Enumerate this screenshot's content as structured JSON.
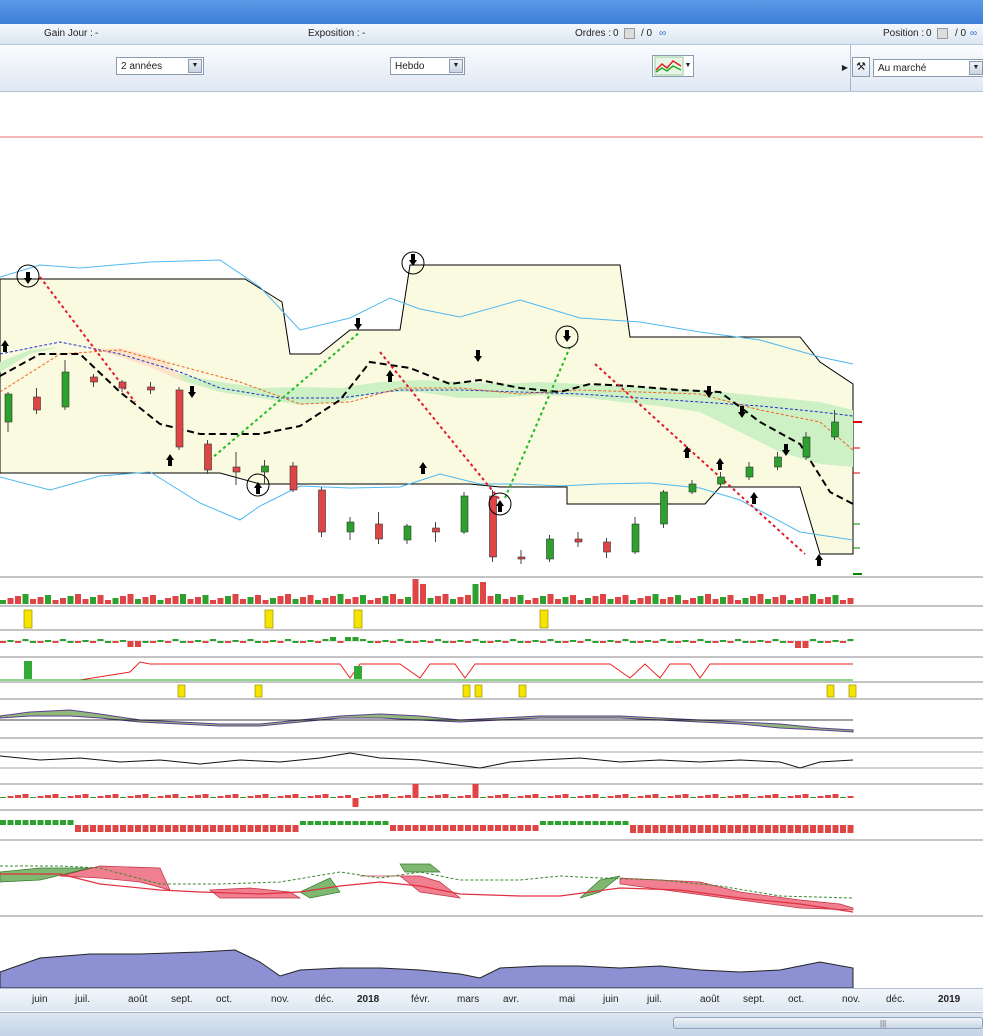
{
  "infobar": {
    "gain_label": "Gain Jour :",
    "gain_value": "-",
    "exposition_label": "Exposition :",
    "exposition_value": "-",
    "ordres_label": "Ordres :",
    "ordres_value1": "0",
    "ordres_value2": "/ 0",
    "position_label": "Position :",
    "position_value1": "0",
    "position_value2": "/ 0"
  },
  "toolbar": {
    "period_select": "2 années",
    "interval_select": "Hebdo",
    "order_type_select": "Au marché"
  },
  "xaxis": {
    "labels": [
      "juin",
      "juil.",
      "août",
      "sept.",
      "oct.",
      "nov.",
      "déc.",
      "2018",
      "févr.",
      "mars",
      "avr.",
      "mai",
      "juin",
      "juil.",
      "août",
      "sept.",
      "oct.",
      "nov.",
      "déc.",
      "2019"
    ],
    "bold_labels": [
      "2018",
      "2019"
    ]
  },
  "chart_data": {
    "type": "candlestick",
    "x": [
      "juin",
      "juil.",
      "août",
      "sept.",
      "oct.",
      "nov.",
      "déc.",
      "2018",
      "févr.",
      "mars",
      "avr.",
      "mai",
      "juin",
      "juil.",
      "août",
      "sept.",
      "oct.",
      "nov."
    ],
    "candles": [
      {
        "o": 330,
        "c": 302,
        "h": 300,
        "l": 340
      },
      {
        "o": 305,
        "c": 318,
        "h": 296,
        "l": 322
      },
      {
        "o": 315,
        "c": 280,
        "h": 268,
        "l": 318
      },
      {
        "o": 285,
        "c": 290,
        "h": 282,
        "l": 295
      },
      {
        "o": 290,
        "c": 296,
        "h": 288,
        "l": 300
      },
      {
        "o": 295,
        "c": 298,
        "h": 290,
        "l": 302
      },
      {
        "o": 298,
        "c": 355,
        "h": 295,
        "l": 358
      },
      {
        "o": 352,
        "c": 378,
        "h": 348,
        "l": 382
      },
      {
        "o": 375,
        "c": 380,
        "h": 360,
        "l": 393
      },
      {
        "o": 380,
        "c": 374,
        "h": 368,
        "l": 392
      },
      {
        "o": 374,
        "c": 398,
        "h": 370,
        "l": 400
      },
      {
        "o": 398,
        "c": 440,
        "h": 395,
        "l": 445
      },
      {
        "o": 440,
        "c": 430,
        "h": 425,
        "l": 448
      },
      {
        "o": 432,
        "c": 447,
        "h": 420,
        "l": 452
      },
      {
        "o": 448,
        "c": 434,
        "h": 432,
        "l": 452
      },
      {
        "o": 436,
        "c": 440,
        "h": 430,
        "l": 450
      },
      {
        "o": 440,
        "c": 404,
        "h": 400,
        "l": 442
      },
      {
        "o": 404,
        "c": 465,
        "h": 398,
        "l": 470
      },
      {
        "o": 465,
        "c": 467,
        "h": 458,
        "l": 472
      },
      {
        "o": 467,
        "c": 447,
        "h": 443,
        "l": 470
      },
      {
        "o": 447,
        "c": 450,
        "h": 440,
        "l": 455
      },
      {
        "o": 450,
        "c": 460,
        "h": 446,
        "l": 466
      },
      {
        "o": 460,
        "c": 432,
        "h": 425,
        "l": 462
      },
      {
        "o": 432,
        "c": 400,
        "h": 398,
        "l": 436
      },
      {
        "o": 400,
        "c": 392,
        "h": 388,
        "l": 402
      },
      {
        "o": 392,
        "c": 385,
        "h": 380,
        "l": 395
      },
      {
        "o": 385,
        "c": 375,
        "h": 370,
        "l": 388
      },
      {
        "o": 375,
        "c": 365,
        "h": 360,
        "l": 378
      },
      {
        "o": 365,
        "c": 345,
        "h": 340,
        "l": 368
      },
      {
        "o": 345,
        "c": 330,
        "h": 318,
        "l": 348
      }
    ]
  }
}
